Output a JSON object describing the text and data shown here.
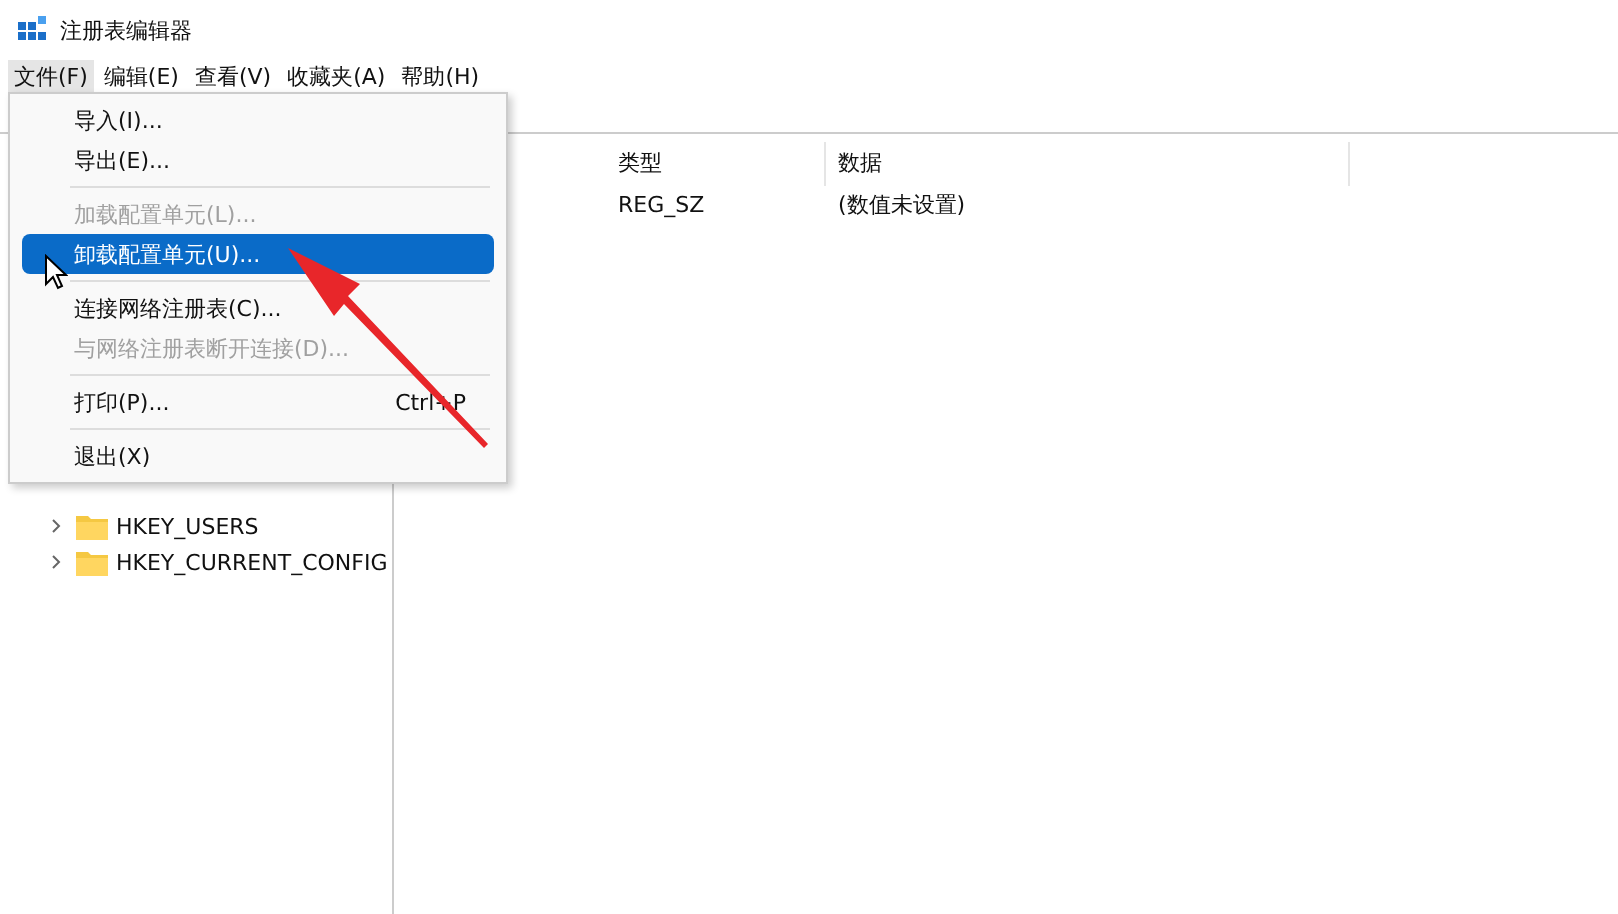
{
  "window": {
    "title": "注册表编辑器"
  },
  "menu_bar": [
    {
      "label": "文件(F)",
      "selected": true
    },
    {
      "label": "编辑(E)",
      "selected": false
    },
    {
      "label": "查看(V)",
      "selected": false
    },
    {
      "label": "收藏夹(A)",
      "selected": false
    },
    {
      "label": "帮助(H)",
      "selected": false
    }
  ],
  "file_menu": [
    {
      "kind": "item",
      "label": "导入(I)...",
      "disabled": false,
      "selected": false
    },
    {
      "kind": "item",
      "label": "导出(E)...",
      "disabled": false,
      "selected": false
    },
    {
      "kind": "separator"
    },
    {
      "kind": "item",
      "label": "加载配置单元(L)...",
      "disabled": true,
      "selected": false
    },
    {
      "kind": "item",
      "label": "卸载配置单元(U)...",
      "disabled": false,
      "selected": true
    },
    {
      "kind": "separator"
    },
    {
      "kind": "item",
      "label": "连接网络注册表(C)...",
      "disabled": false,
      "selected": false
    },
    {
      "kind": "item",
      "label": "与网络注册表断开连接(D)...",
      "disabled": true,
      "selected": false
    },
    {
      "kind": "separator"
    },
    {
      "kind": "item",
      "label": "打印(P)...",
      "shortcut": "Ctrl+P",
      "disabled": false,
      "selected": false
    },
    {
      "kind": "separator"
    },
    {
      "kind": "item",
      "label": "退出(X)",
      "disabled": false,
      "selected": false
    }
  ],
  "tree": [
    {
      "label": "HKEY_USERS",
      "expanded": false
    },
    {
      "label": "HKEY_CURRENT_CONFIG",
      "expanded": false
    }
  ],
  "table": {
    "columns": [
      "类型",
      "数据"
    ],
    "rows": [
      [
        "REG_SZ",
        "(数值未设置)"
      ]
    ]
  }
}
